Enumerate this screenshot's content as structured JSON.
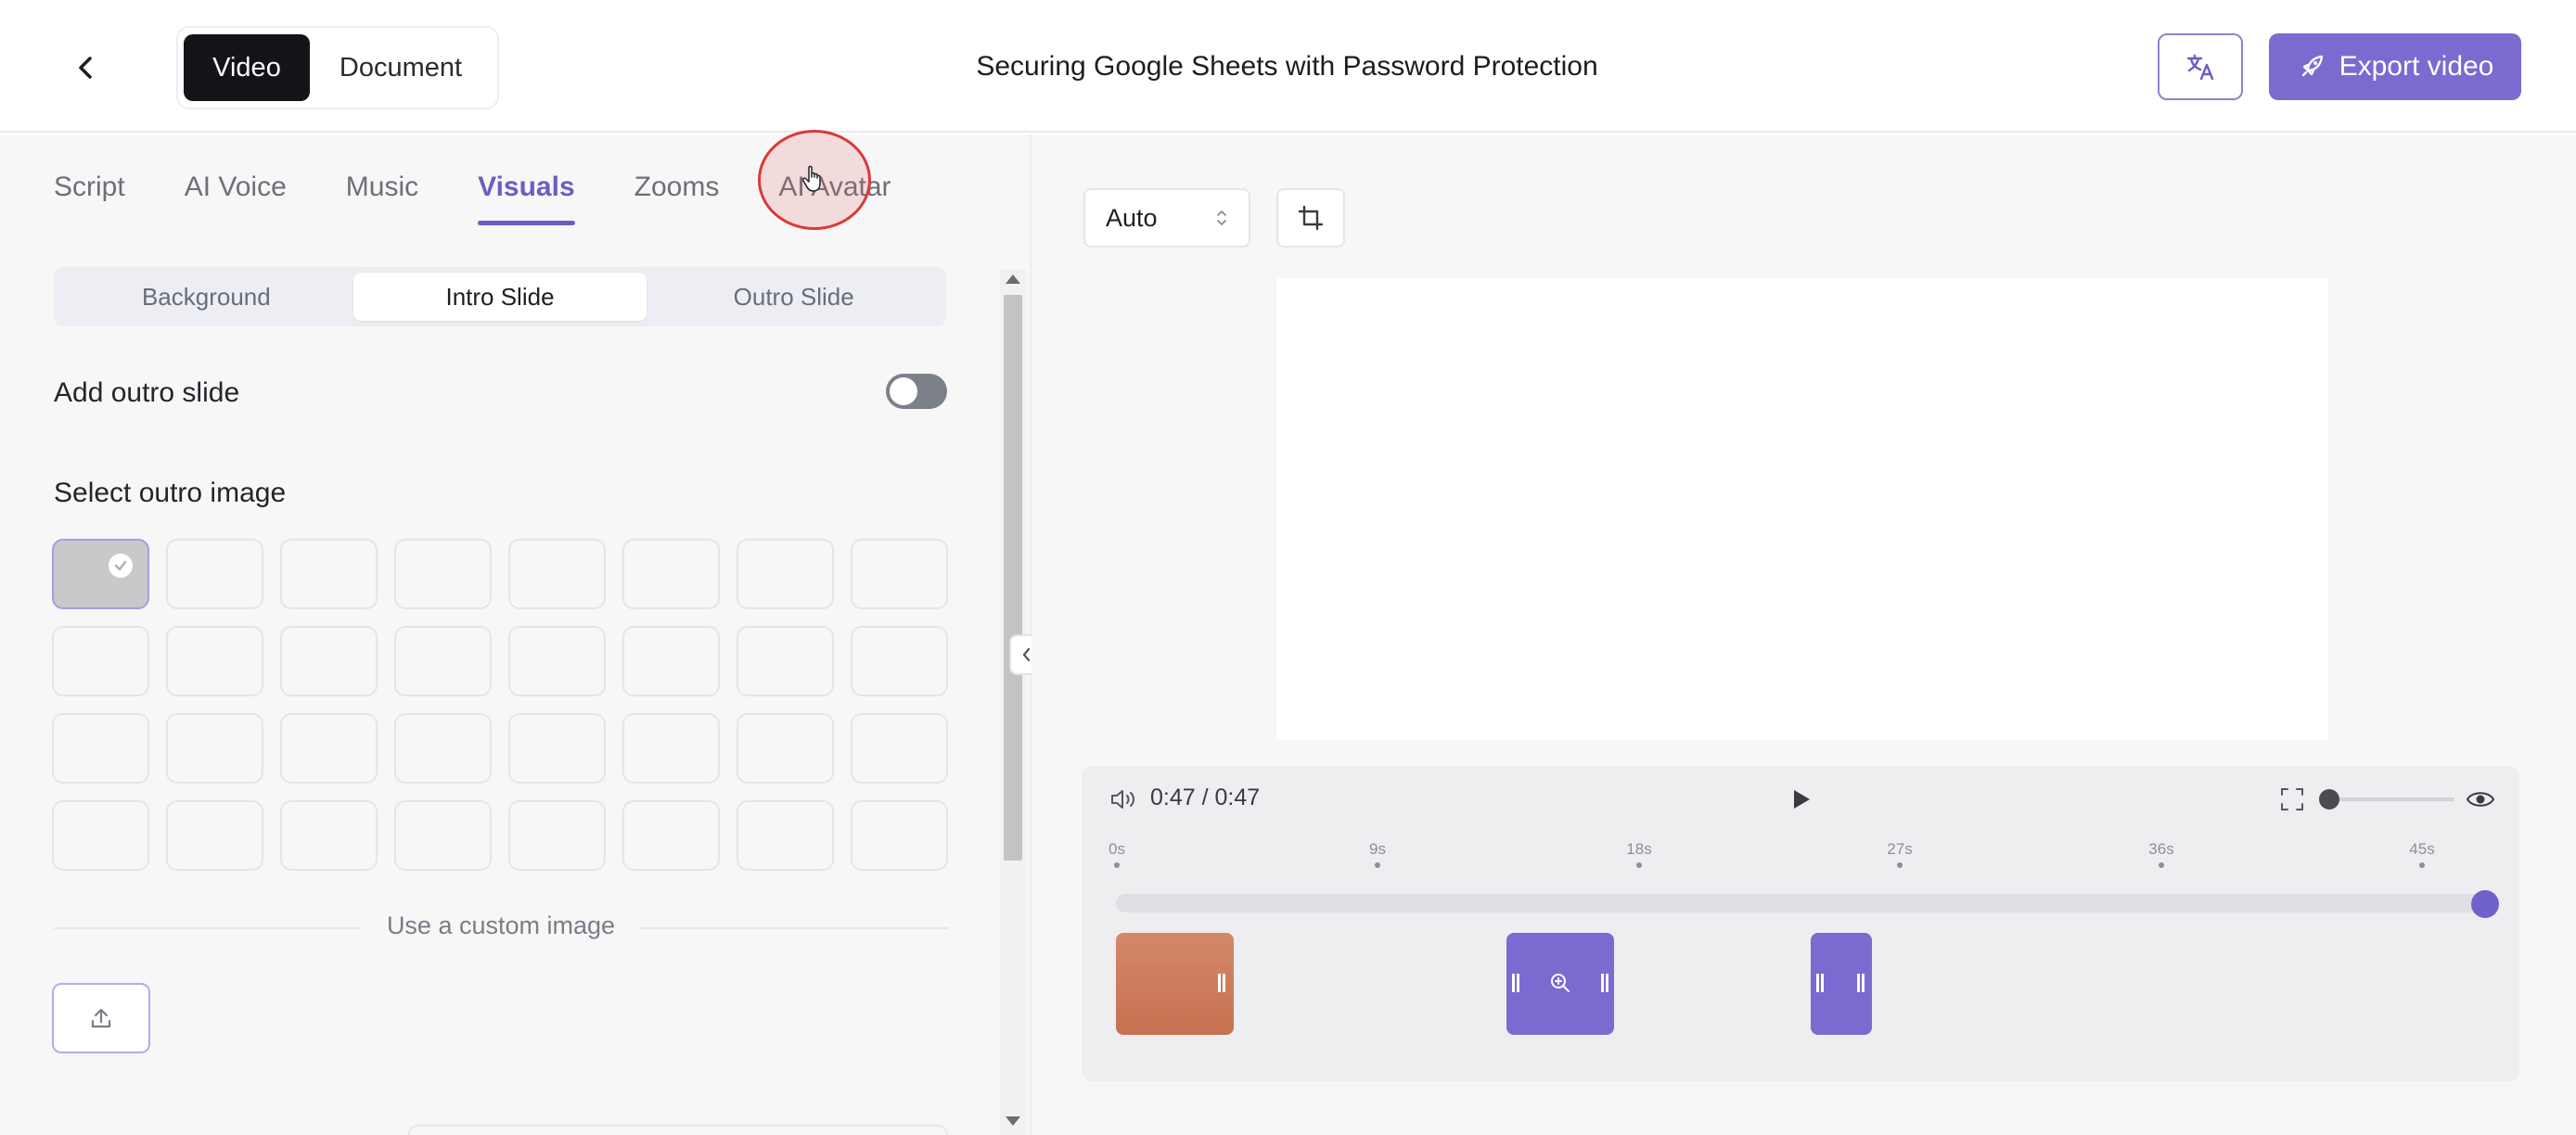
{
  "header": {
    "mode_video": "Video",
    "mode_document": "Document",
    "title": "Securing Google Sheets with Password Protection",
    "export_label": "Export video"
  },
  "tabs": [
    "Script",
    "AI Voice",
    "Music",
    "Visuals",
    "Zooms",
    "AI Avatar"
  ],
  "active_tab": "Visuals",
  "subtabs": [
    "Background",
    "Intro Slide",
    "Outro Slide"
  ],
  "active_subtab": "Intro Slide",
  "outro": {
    "add_label": "Add outro slide",
    "add_enabled": false,
    "select_label": "Select outro image",
    "custom_label": "Use a custom image"
  },
  "preview": {
    "ratio": "Auto"
  },
  "player": {
    "time": "0:47 / 0:47",
    "ticks": [
      "0s",
      "9s",
      "18s",
      "27s",
      "36s",
      "45s"
    ],
    "progress": 1.0
  },
  "colors": {
    "accent": "#7a6bd1",
    "clip_orange": "#c67150",
    "dark": "#141418"
  }
}
